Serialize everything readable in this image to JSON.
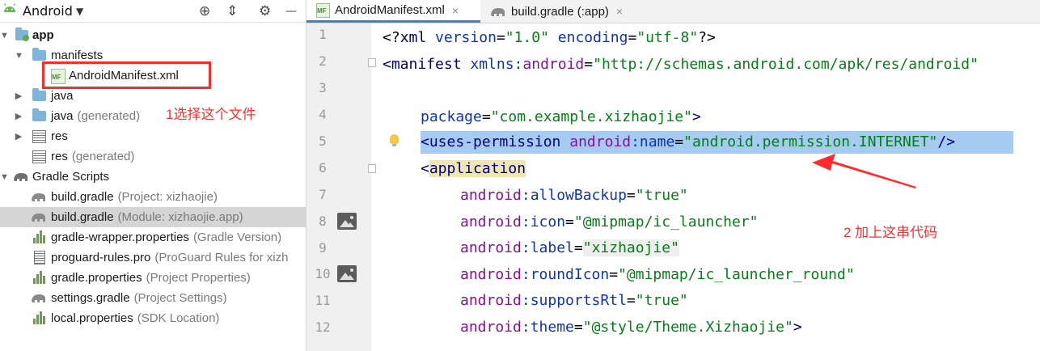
{
  "project_panel": {
    "title": "Android",
    "dropdown_icon": "▼",
    "tools": {
      "target": "⊕",
      "collapse": "⇕",
      "settings": "⚙",
      "minimize": "—"
    },
    "tree": [
      {
        "label": "app",
        "hint": "",
        "arrow": "▼",
        "bold": true
      },
      {
        "label": "manifests",
        "hint": "",
        "arrow": "▼"
      },
      {
        "label": "AndroidManifest.xml",
        "hint": ""
      },
      {
        "label": "java",
        "hint": "",
        "arrow": "▶"
      },
      {
        "label": "java",
        "hint": "(generated)",
        "arrow": "▶"
      },
      {
        "label": "res",
        "hint": "",
        "arrow": "▶"
      },
      {
        "label": "res",
        "hint": "(generated)",
        "arrow": ""
      },
      {
        "label": "Gradle Scripts",
        "hint": "",
        "arrow": "▼"
      },
      {
        "label": "build.gradle",
        "hint": "(Project: xizhaojie)"
      },
      {
        "label": "build.gradle",
        "hint": "(Module: xizhaojie.app)"
      },
      {
        "label": "gradle-wrapper.properties",
        "hint": "(Gradle Version)"
      },
      {
        "label": "proguard-rules.pro",
        "hint": "(ProGuard Rules for xizh"
      },
      {
        "label": "gradle.properties",
        "hint": "(Project Properties)"
      },
      {
        "label": "settings.gradle",
        "hint": "(Project Settings)"
      },
      {
        "label": "local.properties",
        "hint": "(SDK Location)"
      }
    ],
    "mf_badge": "MF"
  },
  "annotations": {
    "step1": "1选择这个文件",
    "step2": "2 加上这串代码",
    "color": "#ff2a2a"
  },
  "tabs": [
    {
      "label": "AndroidManifest.xml",
      "close": "×",
      "active": true
    },
    {
      "label": "build.gradle (:app)",
      "close": "×",
      "active": false
    }
  ],
  "gutter": {
    "line_numbers": [
      "1",
      "2",
      "3",
      "4",
      "5",
      "6",
      "7",
      "8",
      "9",
      "10",
      "11",
      "12"
    ]
  },
  "code": {
    "l1": {
      "a": "<?",
      "b": "xml ",
      "c": "version",
      "d": "=",
      "e": "\"1.0\"",
      "f": " ",
      "g": "encoding",
      "h": "=",
      "i": "\"utf-8\"",
      "j": "?>"
    },
    "l2": {
      "a": "<manifest ",
      "b": "xmlns:",
      "c": "android",
      "d": "=",
      "e": "\"http://schemas.android.com/apk/res/android\""
    },
    "l4": {
      "a": "package",
      "b": "=",
      "c": "\"com.example.xizhaojie\"",
      "d": ">"
    },
    "l5": {
      "a": "<uses-permission ",
      "b": "android",
      "c": ":name",
      "d": "=",
      "e": "\"android.permission.INTERNET\"",
      "f": "/>"
    },
    "l6": {
      "a": "<",
      "b": "application"
    },
    "l7": {
      "ns": "android",
      "attr": ":allowBackup",
      "eq": "=",
      "val": "\"true\""
    },
    "l8": {
      "ns": "android",
      "attr": ":icon",
      "eq": "=",
      "val": "\"@mipmap/ic_launcher\""
    },
    "l9": {
      "ns": "android",
      "attr": ":label",
      "eq": "=",
      "val": "\"xizhaojie\""
    },
    "l10": {
      "ns": "android",
      "attr": ":roundIcon",
      "eq": "=",
      "val": "\"@mipmap/ic_launcher_round\""
    },
    "l11": {
      "ns": "android",
      "attr": ":supportsRtl",
      "eq": "=",
      "val": "\"true\""
    },
    "l12": {
      "ns": "android",
      "attr": ":theme",
      "eq": "=",
      "val": "\"@style/Theme.Xizhaojie\"",
      "end": ">"
    }
  },
  "colors": {
    "selection": "#a6cbf1",
    "tag": "#000080",
    "attribute": "#0d34b6",
    "namespace": "#871094",
    "value": "#067d17",
    "active_tab_underline": "#4083c9"
  },
  "icons": [
    "android-icon",
    "folder-icon",
    "manifest-file-icon",
    "gradle-elephant-icon",
    "properties-file-icon",
    "text-file-icon",
    "bulb-icon",
    "image-icon",
    "fold-icon"
  ]
}
